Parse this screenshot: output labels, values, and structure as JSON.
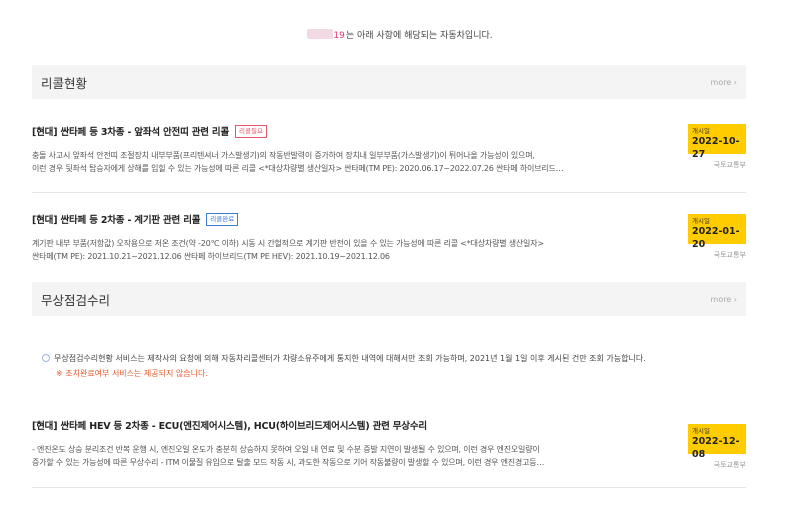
{
  "notice": {
    "plate_suffix": "19",
    "text": "는 아래 사항에 해당되는 자동차입니다."
  },
  "recall_section": {
    "title": "리콜현황",
    "more": "more ›",
    "items": [
      {
        "title": "[현대] 싼타페 등 3차종 - 앞좌석 안전띠 관련 리콜",
        "badge": "리콜필요",
        "desc_line1": "충돌 사고시 앞좌석 안전띠 조절장치 내부부품(프리텐셔너 가스발생기)의 작동반발력이 증가하여 장치내 일부부품(가스발생기)이 튀어나올 가능성이 있으며,",
        "desc_line2": "이런 경우 뒷좌석 탑승자에게 상해를 입힐 수 있는 가능성에 따른 리콜 <*대상차량별 생산일자> 싼타페(TM PE): 2020.06.17~2022.07.26 싼타페 하이브리드…",
        "date_label": "개시일",
        "date": "2022-10-27",
        "agency": "국토교통부"
      },
      {
        "title": "[현대] 싼타페 등 2차종 - 계기판 관련 리콜",
        "badge": "리콜완료",
        "desc_line1": "계기판 내부 부품(저항값) 오작용으로 저온 조건(약 -20℃ 이하) 시동 시 간헐적으로 계기판 반전이 있을 수 있는 가능성에 따른 리콜 <*대상차량별 생산일자>",
        "desc_line2": "싼타페(TM PE): 2021.10.21~2021.12.06 싼타페 하이브리드(TM PE HEV): 2021.10.19~2021.12.06",
        "date_label": "개시일",
        "date": "2022-01-20",
        "agency": "국토교통부"
      }
    ]
  },
  "free_section": {
    "title": "무상점검수리",
    "more": "more ›",
    "info_line1": "무상점검수리현황 서비스는 제작사의 요청에 의해 자동차리콜센터가 차량소유주에게 통지한 내역에 대해서만 조회 가능하며, 2021년 1월 1일 이후 게시된 건만 조회 가능합니다.",
    "info_line2": "※ 조치완료여부 서비스는 제공되지 않습니다.",
    "items": [
      {
        "title": "[현대] 싼타페 HEV 등 2차종 - ECU(엔진제어시스템), HCU(하이브리드제어시스템) 관련 무상수리",
        "desc_line1": "- 엔진온도 상승 분리조건 반복 운행 시, 엔진오일 온도가 충분히 상승하지 못하여 오일 내 연료 및 수분 증발 지연이 발생될 수 있으며, 이런 경우 엔진오일량이",
        "desc_line2": "증가할 수 있는 가능성에 따른 무상수리 - ITM 이물질 유입으로 탈출 모드 작동 시, 과도한 작동으로 기어 작동불량이 발생할 수 있으며, 이런 경우 엔진경고등…",
        "date_label": "개시일",
        "date": "2022-12-08",
        "agency": "국토교통부"
      }
    ]
  }
}
